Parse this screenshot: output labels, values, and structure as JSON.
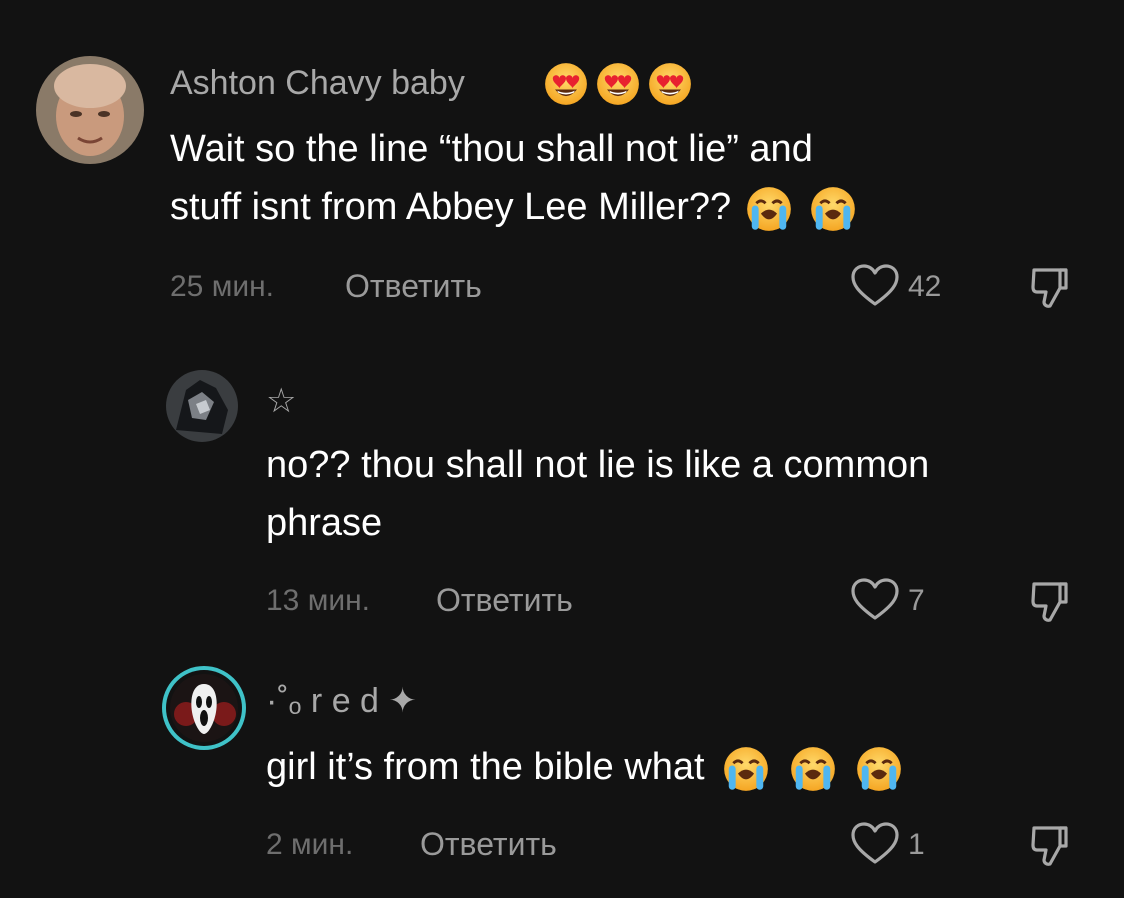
{
  "comments": [
    {
      "username": "Ashton Chavy baby",
      "username_emoji": "heart-eyes-emoji",
      "text_line1": "Wait so the line “thou shall not lie” and",
      "text_line2": "stuff isnt from Abbey Lee Miller??",
      "text_emoji": "loudly-crying-emoji",
      "time": "25 мин.",
      "reply_label": "Ответить",
      "likes": "42"
    },
    {
      "username": "☆",
      "text_line1": "no?? thou shall not lie is like a common",
      "text_line2": "phrase",
      "time": "13 мин.",
      "reply_label": "Ответить",
      "likes": "7"
    },
    {
      "username": "·˚ₒ r e d ✦",
      "text_line1": "girl it’s from the bible what",
      "text_emoji": "loudly-crying-emoji",
      "time": "2 мин.",
      "reply_label": "Ответить",
      "likes": "1"
    }
  ],
  "colors": {
    "background": "#121212",
    "username": "#a8a8a8",
    "body_text": "#ffffff",
    "meta": "#9a9a9a",
    "story_ring": "#3fc2c8"
  }
}
